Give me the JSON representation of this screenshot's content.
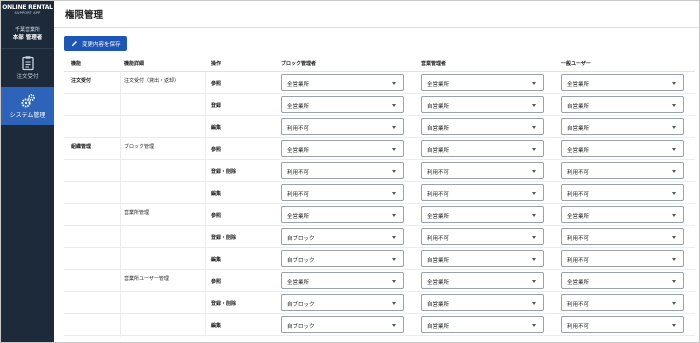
{
  "brand": {
    "line1": "ONLINE RENTAL",
    "line2": "SUPPORT APP"
  },
  "user": {
    "company": "千葉営業所",
    "name": "本部 管理者"
  },
  "nav": [
    {
      "label": "注文受付",
      "icon": "clipboard-icon",
      "active": false
    },
    {
      "label": "システム管理",
      "icon": "gears-icon",
      "active": true
    }
  ],
  "page": {
    "title": "権限管理"
  },
  "toolbar": {
    "save_label": "変更内容を保存"
  },
  "columns": {
    "feature": "機能",
    "detail": "機能詳細",
    "operation": "操作",
    "block_manager": "ブロック管理者",
    "office_manager": "営業管理者",
    "general_user": "一般ユーザー"
  },
  "groups": [
    {
      "feature": "注文受付",
      "details": [
        {
          "detail": "注文受付（貸出・返却）"
        }
      ]
    },
    {
      "feature": "組織管理",
      "details": [
        {
          "detail": "ブロック管理"
        },
        {
          "detail": "営業所管理"
        },
        {
          "detail": "営業所ユーザー管理"
        }
      ]
    }
  ],
  "rows": [
    {
      "op": "参照",
      "block": "全営業所",
      "office": "全営業所",
      "general": "全営業所"
    },
    {
      "op": "登録",
      "block": "全営業所",
      "office": "自営業所",
      "general": "自営業所"
    },
    {
      "op": "編集",
      "block": "利用不可",
      "office": "自営業所",
      "general": "自営業所"
    },
    {
      "op": "参照",
      "block": "全営業所",
      "office": "自営業所",
      "general": "全営業所"
    },
    {
      "op": "登録・削除",
      "block": "利用不可",
      "office": "利用不可",
      "general": "利用不可"
    },
    {
      "op": "編集",
      "block": "利用不可",
      "office": "利用不可",
      "general": "利用不可"
    },
    {
      "op": "参照",
      "block": "全営業所",
      "office": "全営業所",
      "general": "全営業所"
    },
    {
      "op": "登録・削除",
      "block": "自ブロック",
      "office": "利用不可",
      "general": "利用不可"
    },
    {
      "op": "編集",
      "block": "自ブロック",
      "office": "自営業所",
      "general": "利用不可"
    },
    {
      "op": "参照",
      "block": "全営業所",
      "office": "全営業所",
      "general": "全営業所"
    },
    {
      "op": "登録・削除",
      "block": "自ブロック",
      "office": "自営業所",
      "general": "利用不可"
    },
    {
      "op": "編集",
      "block": "自ブロック",
      "office": "自営業所",
      "general": "利用不可"
    }
  ],
  "colors": {
    "sidebar": "#1c2a3a",
    "active": "#2d63b8",
    "primary_button": "#1e56b6"
  }
}
